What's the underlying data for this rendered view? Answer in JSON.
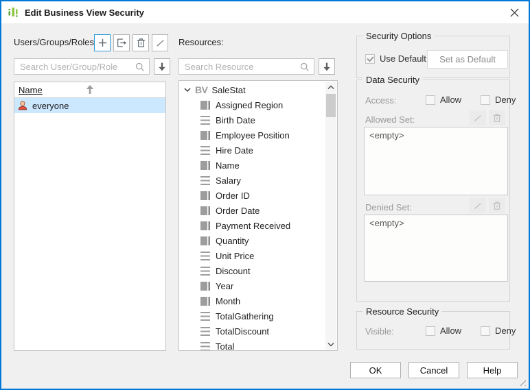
{
  "window": {
    "title": "Edit Business View Security"
  },
  "users_panel": {
    "label": "Users/Groups/Roles:",
    "toolbar": {
      "add": "add",
      "export": "export",
      "delete": "delete",
      "edit": "edit"
    },
    "search_placeholder": "Search User/Group/Role",
    "list_header": "Name",
    "rows": [
      {
        "label": "everyone"
      }
    ]
  },
  "resources_panel": {
    "label": "Resources:",
    "search_placeholder": "Search Resource",
    "tree": {
      "root_badge": "BV",
      "root_label": "SaleStat",
      "items": [
        {
          "label": "Assigned Region",
          "icon": "dimension"
        },
        {
          "label": "Birth Date",
          "icon": "measure"
        },
        {
          "label": "Employee Position",
          "icon": "dimension"
        },
        {
          "label": "Hire Date",
          "icon": "measure"
        },
        {
          "label": "Name",
          "icon": "dimension"
        },
        {
          "label": "Salary",
          "icon": "measure"
        },
        {
          "label": "Order ID",
          "icon": "dimension"
        },
        {
          "label": "Order Date",
          "icon": "dimension"
        },
        {
          "label": "Payment Received",
          "icon": "dimension"
        },
        {
          "label": "Quantity",
          "icon": "dimension"
        },
        {
          "label": "Unit Price",
          "icon": "measure"
        },
        {
          "label": "Discount",
          "icon": "measure"
        },
        {
          "label": "Year",
          "icon": "dimension"
        },
        {
          "label": "Month",
          "icon": "dimension"
        },
        {
          "label": "TotalGathering",
          "icon": "measure"
        },
        {
          "label": "TotalDiscount",
          "icon": "measure"
        },
        {
          "label": "Total",
          "icon": "measure"
        }
      ]
    }
  },
  "security_options": {
    "legend": "Security Options",
    "use_default_label": "Use Default",
    "use_default_checked": true,
    "set_as_default_label": "Set as Default"
  },
  "data_security": {
    "legend": "Data Security",
    "access_label": "Access:",
    "allow_label": "Allow",
    "deny_label": "Deny",
    "allowed_set_label": "Allowed Set:",
    "allowed_set_value": "<empty>",
    "denied_set_label": "Denied Set:",
    "denied_set_value": "<empty>"
  },
  "resource_security": {
    "legend": "Resource Security",
    "visible_label": "Visible:",
    "allow_label": "Allow",
    "deny_label": "Deny"
  },
  "footer": {
    "ok": "OK",
    "cancel": "Cancel",
    "help": "Help"
  },
  "colors": {
    "dialog_border": "#0078d7",
    "selection": "#cce8ff",
    "accent_button_border": "#2b99d9",
    "brand_green_light": "#8dc63f",
    "brand_green_dark": "#56a036",
    "person_icon": "#e2523c"
  }
}
